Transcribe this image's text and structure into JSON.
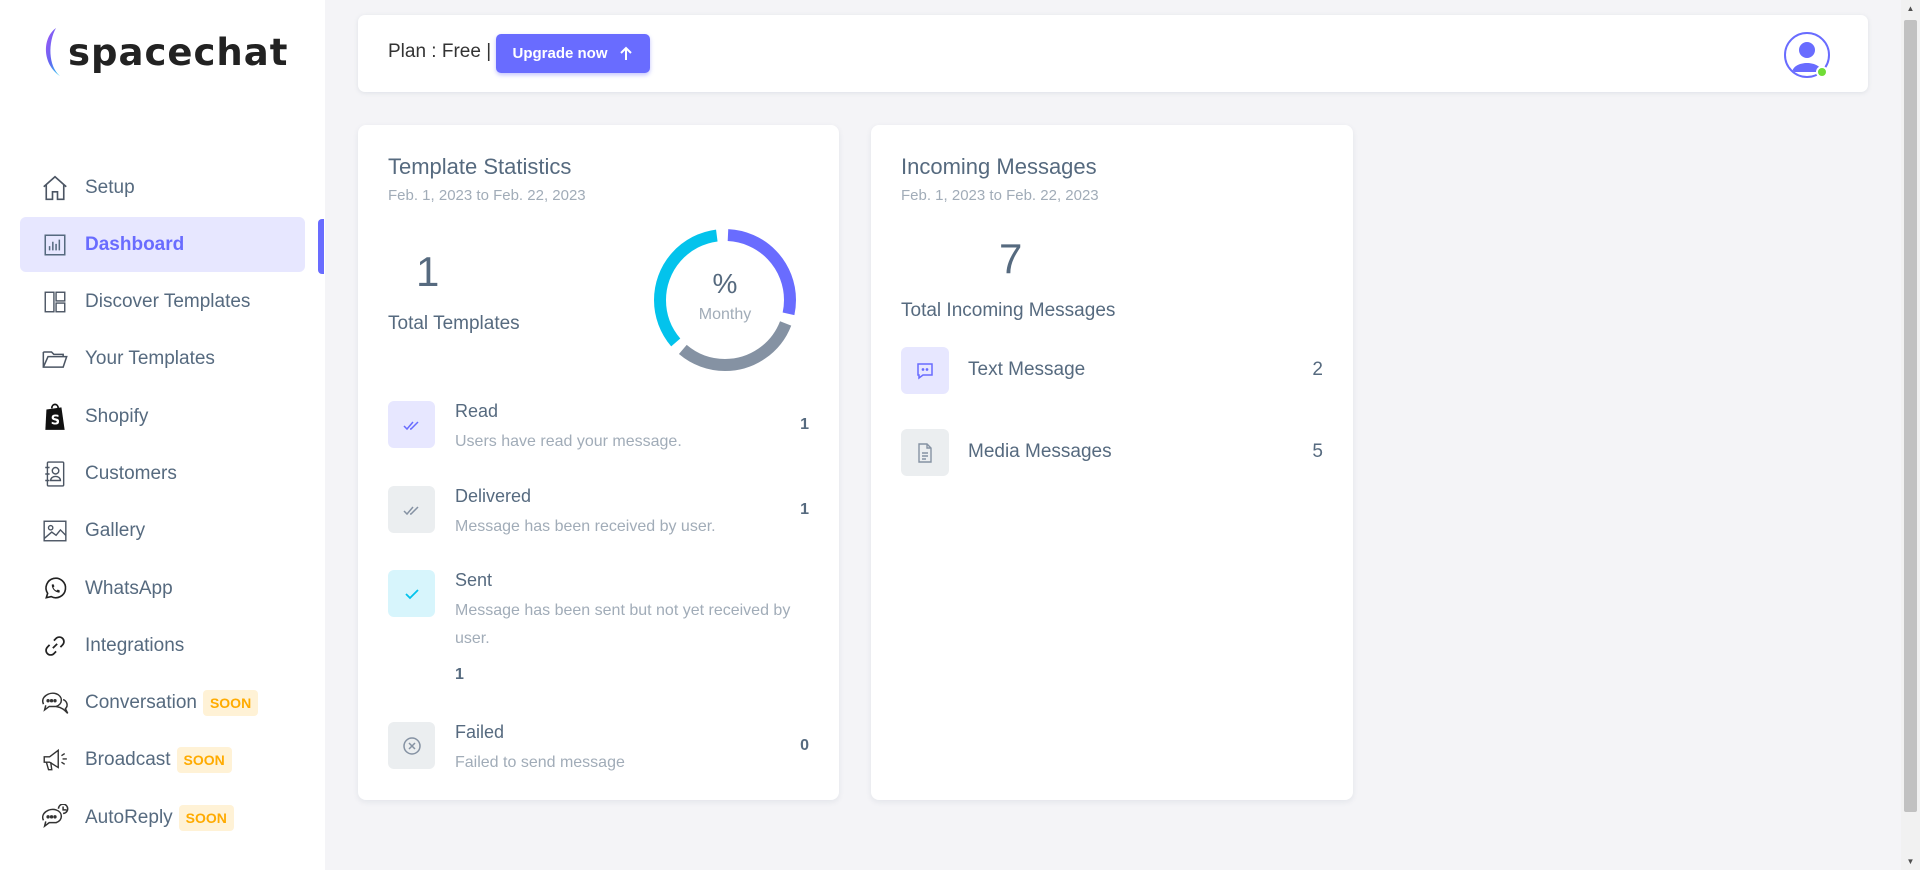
{
  "brand": {
    "name": "spacechat"
  },
  "sidebar": {
    "items": [
      {
        "label": "Setup",
        "icon": "home-icon",
        "soon": ""
      },
      {
        "label": "Dashboard",
        "icon": "bar-chart-icon",
        "soon": ""
      },
      {
        "label": "Discover Templates",
        "icon": "layout-icon",
        "soon": ""
      },
      {
        "label": "Your Templates",
        "icon": "folder-open-icon",
        "soon": ""
      },
      {
        "label": "Shopify",
        "icon": "shopify-icon",
        "soon": ""
      },
      {
        "label": "Customers",
        "icon": "contact-book-icon",
        "soon": ""
      },
      {
        "label": "Gallery",
        "icon": "image-icon",
        "soon": ""
      },
      {
        "label": "WhatsApp",
        "icon": "whatsapp-icon",
        "soon": ""
      },
      {
        "label": "Integrations",
        "icon": "link-icon",
        "soon": ""
      },
      {
        "label": "Conversation",
        "icon": "chat-bubbles-icon",
        "soon": "SOON"
      },
      {
        "label": "Broadcast",
        "icon": "megaphone-icon",
        "soon": "SOON"
      },
      {
        "label": "AutoReply",
        "icon": "auto-reply-icon",
        "soon": "SOON"
      }
    ],
    "active_index": 1
  },
  "navbar": {
    "plan_text": "Plan : Free |",
    "upgrade_label": "Upgrade now"
  },
  "template_stats": {
    "title": "Template Statistics",
    "date_range": "Feb. 1, 2023 to Feb. 22, 2023",
    "total": "1",
    "total_label": "Total Templates",
    "donut_center": "%",
    "donut_sub": "Monthy",
    "rows": [
      {
        "title": "Read",
        "desc": "Users have read your message.",
        "value": "1",
        "icon": "double-check-icon"
      },
      {
        "title": "Delivered",
        "desc": "Message has been received by user.",
        "value": "1",
        "icon": "double-check-icon"
      },
      {
        "title": "Sent",
        "desc": "Message has been sent but not yet received by user.",
        "value": "1",
        "icon": "check-icon"
      },
      {
        "title": "Failed",
        "desc": "Failed to send message",
        "value": "0",
        "icon": "x-circle-icon"
      }
    ]
  },
  "incoming": {
    "title": "Incoming Messages",
    "date_range": "Feb. 1, 2023 to Feb. 22, 2023",
    "total": "7",
    "total_label": "Total Incoming Messages",
    "rows": [
      {
        "label": "Text Message",
        "value": "2",
        "icon": "message-dots-icon"
      },
      {
        "label": "Media Messages",
        "value": "5",
        "icon": "file-icon"
      }
    ]
  },
  "colors": {
    "accent": "#696cff",
    "cyan": "#03c3ec",
    "gray": "#8592a3",
    "soon_bg": "#fff2d6",
    "soon_text": "#ffab00"
  }
}
